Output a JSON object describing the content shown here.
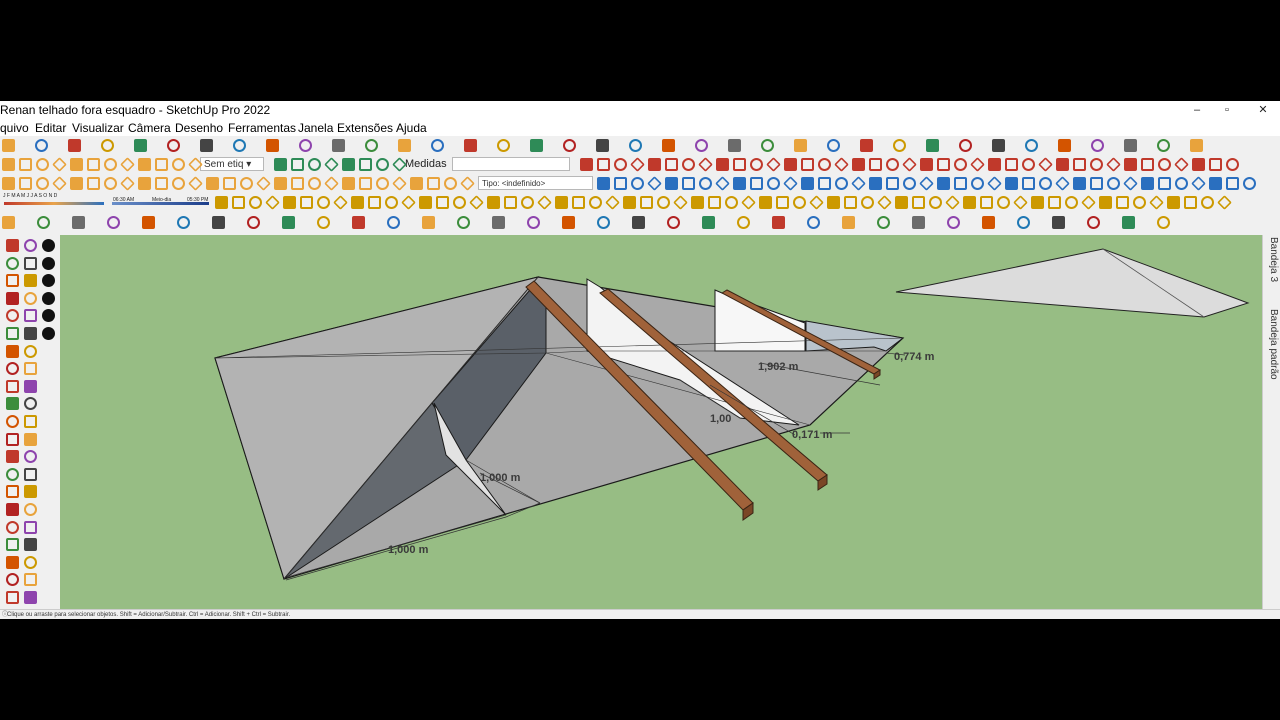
{
  "window": {
    "title": "Renan telhado fora esquadro - SketchUp Pro 2022",
    "minimize": "–",
    "maximize": "▫",
    "close": "✕"
  },
  "menu": [
    "quivo",
    "Editar",
    "Visualizar",
    "Câmera",
    "Desenho",
    "Ferramentas",
    "Janela",
    "Extensões",
    "Ajuda"
  ],
  "toolbar": {
    "tag_select": "Sem etiq",
    "measurements_label": "Medidas",
    "type_field": "Tipo: <indefinido>",
    "shadow_time_1": "06:30 AM",
    "shadow_label": "Meio-dia",
    "shadow_time_2": "05:30 PM",
    "months": "J F M A M J J A S O N D"
  },
  "viewport": {
    "background": "#97bd84",
    "dimensions": [
      "1,902 m",
      "0,774 m",
      "1,00",
      "0,171 m",
      "1,000 m",
      "1,000 m"
    ]
  },
  "trays": [
    "Bandeja 3",
    "Bandeja padrão"
  ],
  "status": {
    "text": "Clique ou arraste para selecionar objetos. Shift = Adicionar/Subtrair. Ctrl = Adicionar. Shift + Ctrl = Subtrair."
  },
  "colors": {
    "accent_red": "#c0392b",
    "accent_blue": "#2a6fbf",
    "wood": "#a0623a",
    "roof": "#a9a9a9"
  }
}
